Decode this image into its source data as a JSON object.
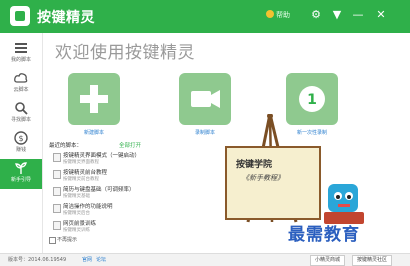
{
  "titlebar": {
    "title": "按键精灵",
    "help_label": "帮助",
    "buttons": [
      "⚙",
      "▼",
      "—",
      "✕"
    ]
  },
  "sidebar": {
    "items": [
      {
        "label": "我的脚本",
        "icon": "list-icon"
      },
      {
        "label": "云脚本",
        "icon": "cloud-icon"
      },
      {
        "label": "寻找脚本",
        "icon": "search-icon"
      },
      {
        "label": "赚钱",
        "icon": "coin-icon"
      },
      {
        "label": "新手引导",
        "icon": "plant-icon"
      }
    ]
  },
  "main": {
    "welcome": "欢迎使用按键精灵",
    "cards": [
      {
        "label": "新建脚本",
        "icon": "plus-icon"
      },
      {
        "label": "录制脚本",
        "icon": "camera-icon"
      },
      {
        "label": "新一次性录制",
        "icon": "number-one-icon"
      }
    ],
    "recent": {
      "title": "最近的脚本：",
      "open_label": "全部打开",
      "items": [
        {
          "name": "按键精灵界面模式（一键启动）",
          "sub": "按键精灵界面教程"
        },
        {
          "name": "按键精灵前台教程",
          "sub": "按键精灵前台教程"
        },
        {
          "name": "简历与键盘基础（可调频率）",
          "sub": "按键精灵基础"
        },
        {
          "name": "简洁操作的功能说明",
          "sub": "按键精灵后台"
        },
        {
          "name": "网页前景训练",
          "sub": "按键精灵训练"
        }
      ]
    },
    "no_show": "不再提示"
  },
  "illustration": {
    "board_title": "按键学院",
    "board_sub": "《新手教程》",
    "watermark": "最需教育"
  },
  "statusbar": {
    "version": "版本号：2014.06.19549",
    "link1": "官网",
    "link2": "论坛",
    "btn1": "小精灵商城",
    "btn2": "按键精灵社区"
  },
  "colors": {
    "accent": "#2fb04a",
    "card": "#8fc98f"
  }
}
